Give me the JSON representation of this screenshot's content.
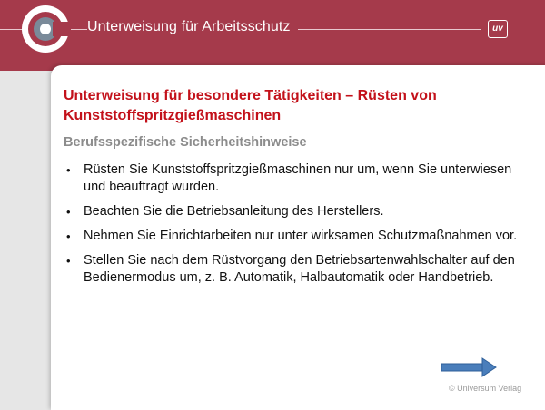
{
  "header": {
    "title": "Unterweisung für Arbeitsschutz",
    "badge": "uv"
  },
  "slide": {
    "title": "Unterweisung für besondere Tätigkeiten – Rüsten von Kunststoffspritzgießmaschinen",
    "subtitle": "Berufsspezifische Sicherheitshinweise",
    "bullets": [
      "Rüsten Sie Kunststoffspritzgießmaschinen nur um, wenn Sie unterwiesen und beauftragt wurden.",
      "Beachten Sie die Betriebsanleitung des Herstellers.",
      "Nehmen Sie Einrichtarbeiten nur unter wirksamen Schutzmaßnahmen vor.",
      "Stellen Sie nach dem Rüstvorgang den Betriebsartenwahlschalter auf den Bedienermodus um, z. B. Automatik, Halbautomatik oder Handbetrieb."
    ]
  },
  "footer": {
    "copyright": "© Universum Verlag",
    "next_icon": "arrow-right-icon"
  },
  "colors": {
    "header_bg": "#a53a4b",
    "title_red": "#c3111a",
    "subtitle_gray": "#8c8c8c",
    "arrow_blue": "#4a7ebb"
  }
}
